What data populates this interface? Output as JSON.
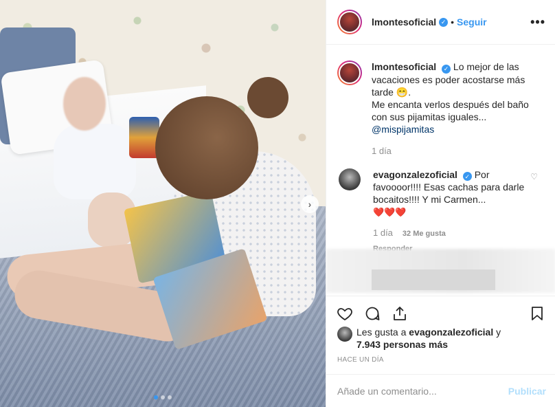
{
  "photo": {
    "carousel_dots": [
      true,
      false,
      false
    ]
  },
  "header": {
    "username": "lmontesoficial",
    "separator": "•",
    "follow_label": "Seguir",
    "more_label": "•••"
  },
  "caption": {
    "username": "lmontesoficial",
    "text_1": "Lo mejor de las vacaciones es poder acostarse más tarde",
    "emoji": "😁",
    "text_2": ".",
    "text_3": "Me encanta verlos después del baño con sus pijamitas iguales...",
    "mention": "@mispijamitas",
    "time": "1 día"
  },
  "comment": {
    "username": "evagonzalezoficial",
    "text": "Por favoooor!!!! Esas cachas para darle bocaitos!!!! Y mi Carmen...",
    "hearts": "❤️❤️❤️",
    "time": "1 día",
    "likes": "32 Me gusta",
    "reply_label": "Responder"
  },
  "likes": {
    "prefix": "Les gusta a",
    "user": "evagonzalezoficial",
    "conj": "y",
    "count": "7.943 personas más"
  },
  "timestamp": "HACE UN DÍA",
  "add_comment": {
    "placeholder": "Añade un comentario...",
    "publish_label": "Publicar"
  },
  "colors": {
    "accent": "#3897f0",
    "publish_disabled": "#b2dffc"
  }
}
